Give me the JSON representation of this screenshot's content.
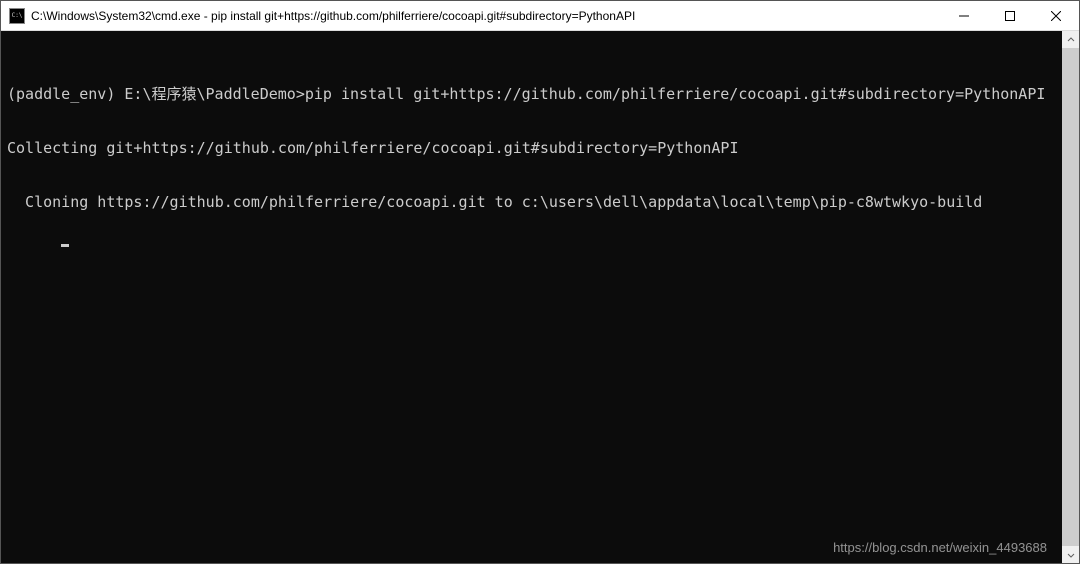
{
  "window": {
    "title": "C:\\Windows\\System32\\cmd.exe - pip  install git+https://github.com/philferriere/cocoapi.git#subdirectory=PythonAPI"
  },
  "terminal": {
    "line1": "(paddle_env) E:\\程序猿\\PaddleDemo>pip install git+https://github.com/philferriere/cocoapi.git#subdirectory=PythonAPI",
    "line2": "Collecting git+https://github.com/philferriere/cocoapi.git#subdirectory=PythonAPI",
    "line3": "  Cloning https://github.com/philferriere/cocoapi.git to c:\\users\\dell\\appdata\\local\\temp\\pip-c8wtwkyo-build"
  },
  "watermark": "https://blog.csdn.net/weixin_4493688"
}
